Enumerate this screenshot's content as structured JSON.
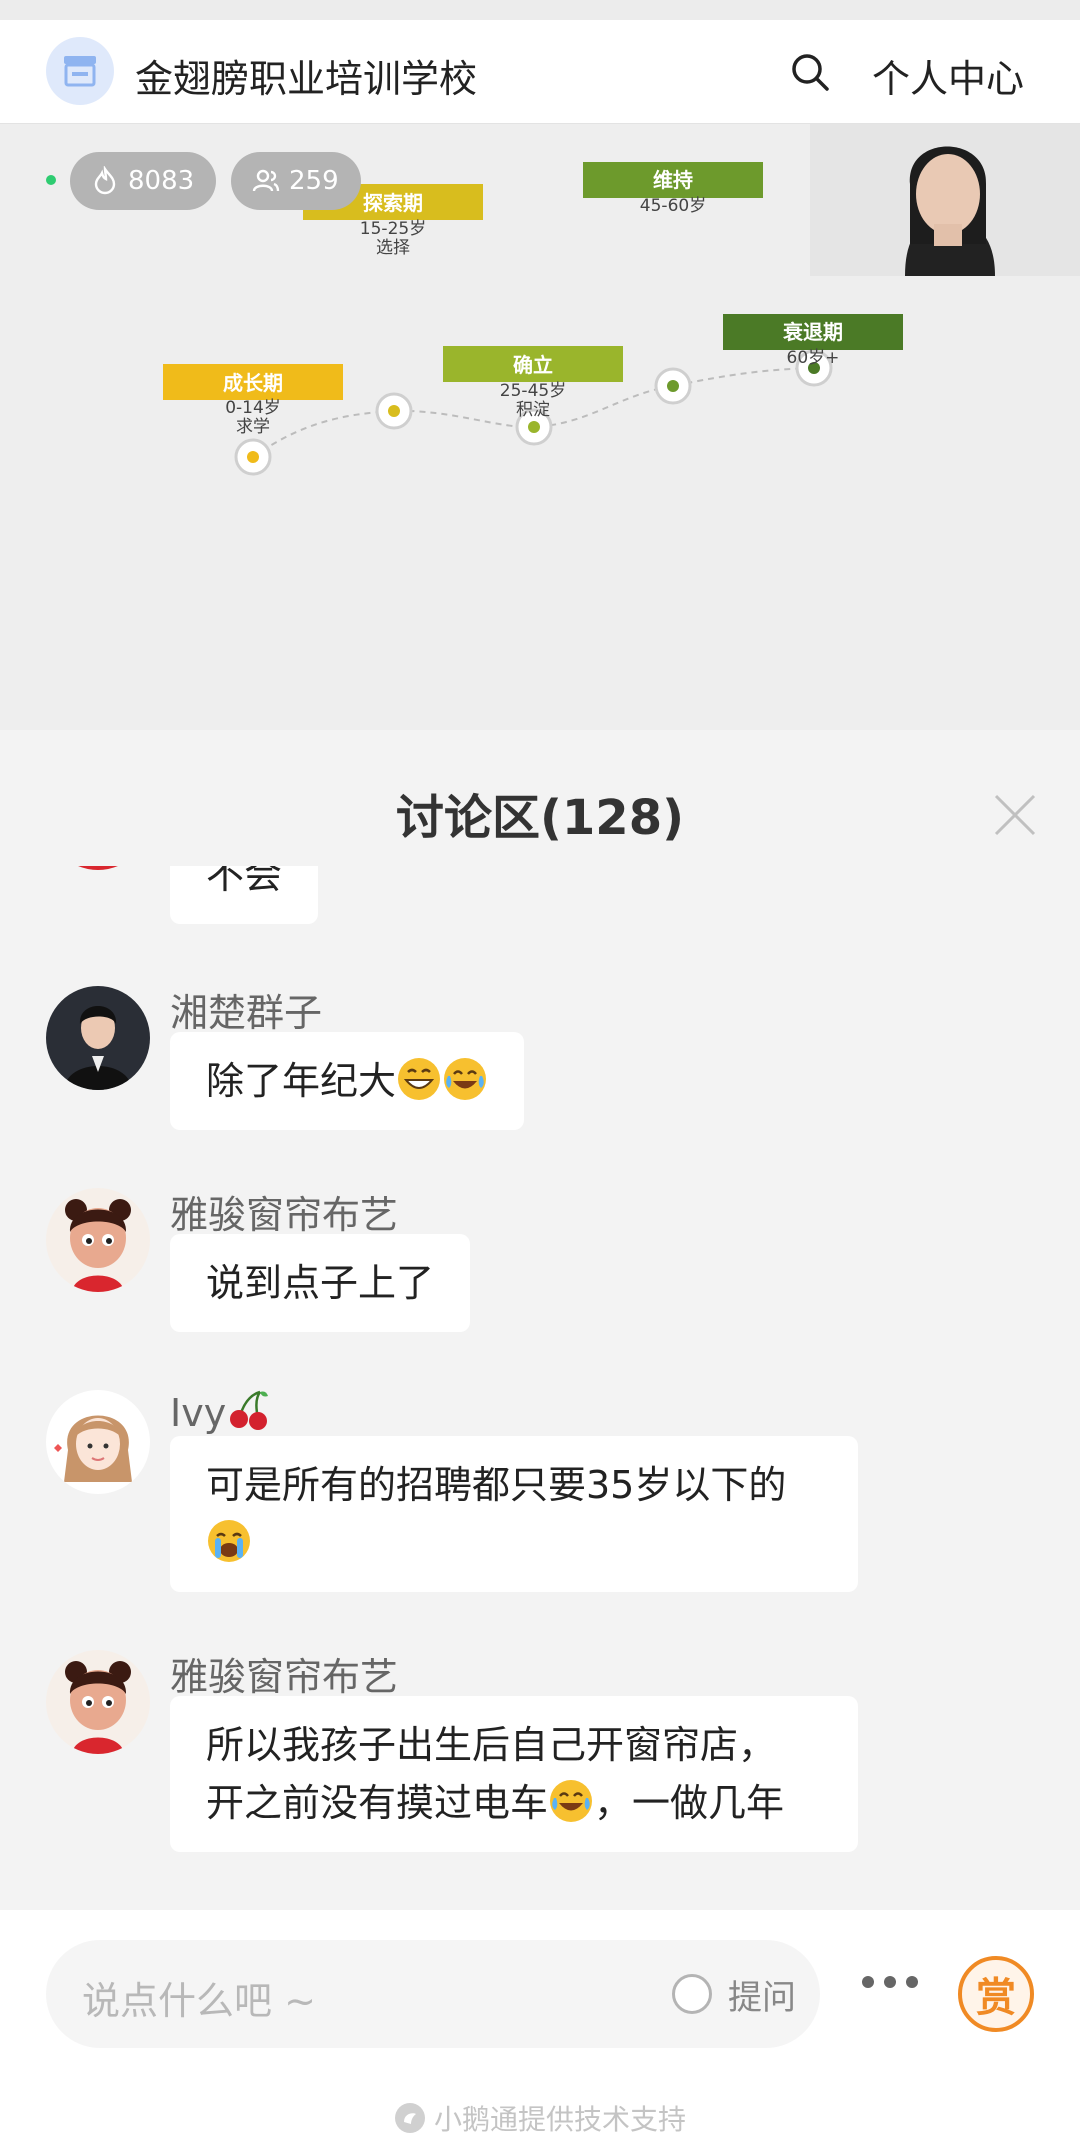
{
  "header": {
    "school_name": "金翅膀职业培训学校",
    "personal_center": "个人中心",
    "logo_icon": "store-icon",
    "search_icon": "search-icon"
  },
  "live": {
    "views": "8083",
    "viewers": "259",
    "views_icon": "flame-icon",
    "viewers_icon": "people-icon"
  },
  "slide": {
    "stages": [
      {
        "label": "成长期",
        "age": "0-14岁",
        "note": "求学",
        "color": "#f0bb1a"
      },
      {
        "label": "探索期",
        "age": "15-25岁",
        "note": "选择",
        "color": "#d8bd1e"
      },
      {
        "label": "确立",
        "age": "25-45岁",
        "note": "积淀",
        "color": "#9ab52c"
      },
      {
        "label": "维持",
        "age": "45-60岁",
        "note": "",
        "color": "#6d9a2c"
      },
      {
        "label": "衰退期",
        "age": "60岁+",
        "note": "",
        "color": "#4b7a26"
      }
    ]
  },
  "discussion": {
    "title": "讨论区(128)",
    "messages": [
      {
        "user": "",
        "text": "不会"
      },
      {
        "user": "湘楚群子",
        "text": "除了年纪大"
      },
      {
        "user": "雅骏窗帘布艺",
        "text": "说到点子上了"
      },
      {
        "user": "Ivy",
        "text": "可是所有的招聘都只要35岁以下的"
      },
      {
        "user": "雅骏窗帘布艺",
        "text_line1": "所以我孩子出生后自己开窗帘店，",
        "text_line2a": "开之前没有摸过电车",
        "text_line2b": "，一做几年"
      }
    ]
  },
  "bottom": {
    "input_placeholder": "说点什么吧 ~",
    "ask_label": "提问",
    "reward_label": "赏",
    "support_text": "小鹅通提供技术支持"
  },
  "colors": {
    "accent_orange": "#f08a24",
    "live_green": "#2ecc71"
  }
}
